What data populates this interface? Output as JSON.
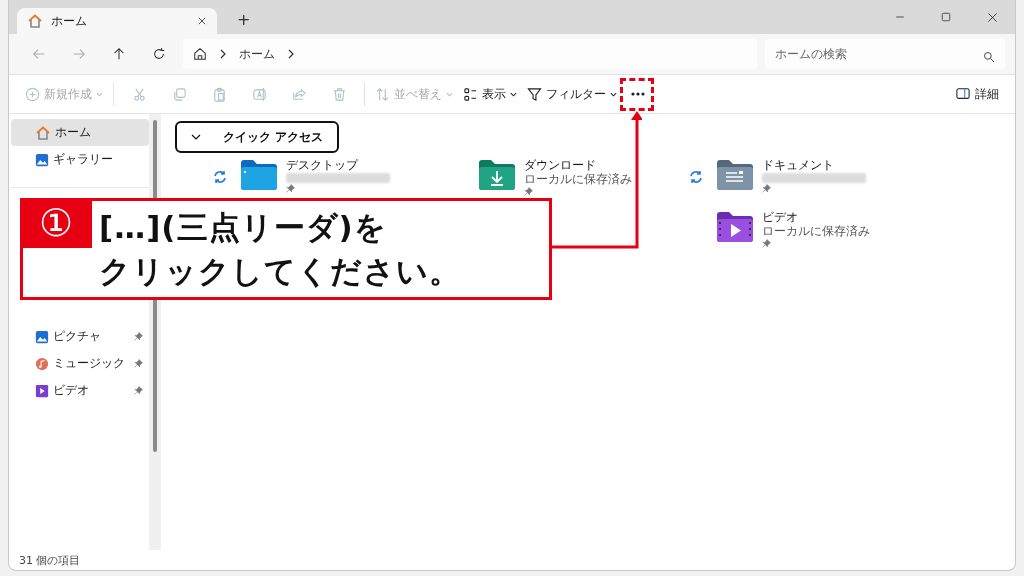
{
  "window": {
    "tabs": [
      {
        "label": "ホーム",
        "selected": true
      }
    ],
    "new_tab": "+"
  },
  "address": {
    "crumbs": [
      "ホーム"
    ],
    "search": {
      "placeholder": "ホームの検索"
    }
  },
  "toolbar": {
    "items": [
      {
        "kind": "new",
        "label": "新規作成",
        "disabled": true,
        "dropdown": true
      },
      {
        "kind": "cut",
        "disabled": true
      },
      {
        "kind": "copy",
        "disabled": true
      },
      {
        "kind": "paste",
        "disabled": true
      },
      {
        "kind": "rename",
        "disabled": true
      },
      {
        "kind": "share",
        "disabled": true
      },
      {
        "kind": "delete",
        "disabled": true
      },
      {
        "kind": "sort",
        "label": "並べ替え",
        "disabled": true,
        "dropdown": true
      },
      {
        "kind": "view",
        "label": "表示",
        "disabled": false,
        "dropdown": true
      },
      {
        "kind": "filter",
        "label": "フィルター",
        "disabled": false,
        "dropdown": true
      },
      {
        "kind": "more",
        "disabled": false
      }
    ],
    "details": {
      "label": "詳細"
    }
  },
  "sidebar": {
    "groups": [
      [
        {
          "label": "ホーム",
          "kind": "home",
          "selected": true,
          "pinned": false
        },
        {
          "label": "ギャラリー",
          "kind": "gallery",
          "selected": false,
          "pinned": false
        }
      ],
      [
        {
          "label": "ピクチャ",
          "kind": "pictures",
          "selected": false,
          "pinned": true
        },
        {
          "label": "ミュージック",
          "kind": "music",
          "selected": false,
          "pinned": true
        },
        {
          "label": "ビデオ",
          "kind": "video",
          "selected": false,
          "pinned": true
        }
      ]
    ]
  },
  "quick_access": {
    "title": "クイック アクセス",
    "expanded": true,
    "rows": [
      [
        {
          "name": "デスクトップ",
          "kind": "desktop",
          "sync": true,
          "redacted": true,
          "pinned": true
        },
        {
          "name": "ダウンロード",
          "kind": "downloads",
          "sync": false,
          "subtitle": "ローカルに保存済み",
          "pinned": true
        },
        {
          "name": "ドキュメント",
          "kind": "documents",
          "sync": true,
          "redacted": true,
          "pinned": true
        }
      ],
      [
        "",
        "",
        {
          "name": "ビデオ",
          "kind": "videos",
          "sync": false,
          "subtitle": "ローカルに保存済み",
          "pinned": true
        }
      ]
    ]
  },
  "status_bar": {
    "count": "31 個の項目"
  },
  "annotation": {
    "step": "①",
    "lines": [
      "[…](三点リーダ)を",
      "クリックしてください。"
    ]
  }
}
